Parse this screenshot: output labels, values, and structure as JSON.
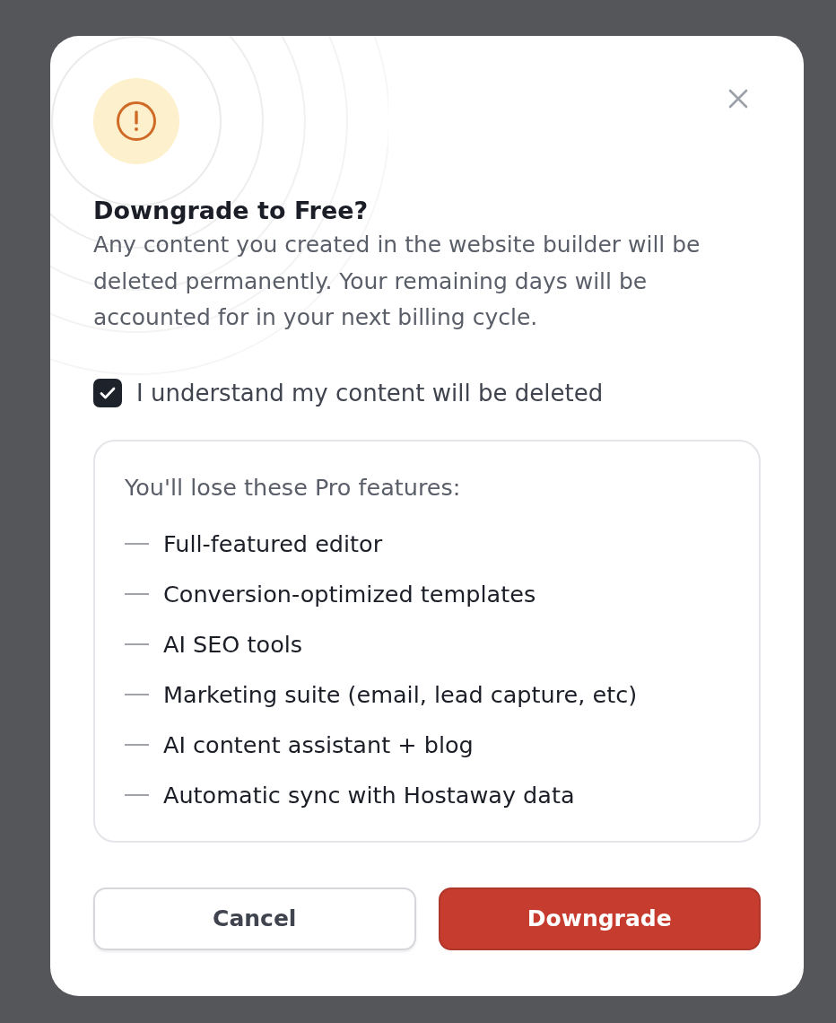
{
  "dialog": {
    "title": "Downgrade to Free?",
    "description": "Any content you created in the website builder will be deleted permanently. Your remaining days will be accounted for in your next billing cycle.",
    "confirmation": {
      "label": "I understand my content will be deleted",
      "checked": true
    },
    "features_panel": {
      "heading": "You'll lose these Pro features:",
      "items": [
        "Full-featured editor",
        "Conversion-optimized templates",
        "AI SEO tools",
        "Marketing suite (email, lead capture, etc)",
        "AI content assistant + blog",
        "Automatic sync with Hostaway data"
      ]
    },
    "buttons": [
      {
        "label": "Cancel",
        "kind": "secondary"
      },
      {
        "label": "Downgrade",
        "kind": "danger"
      }
    ]
  }
}
